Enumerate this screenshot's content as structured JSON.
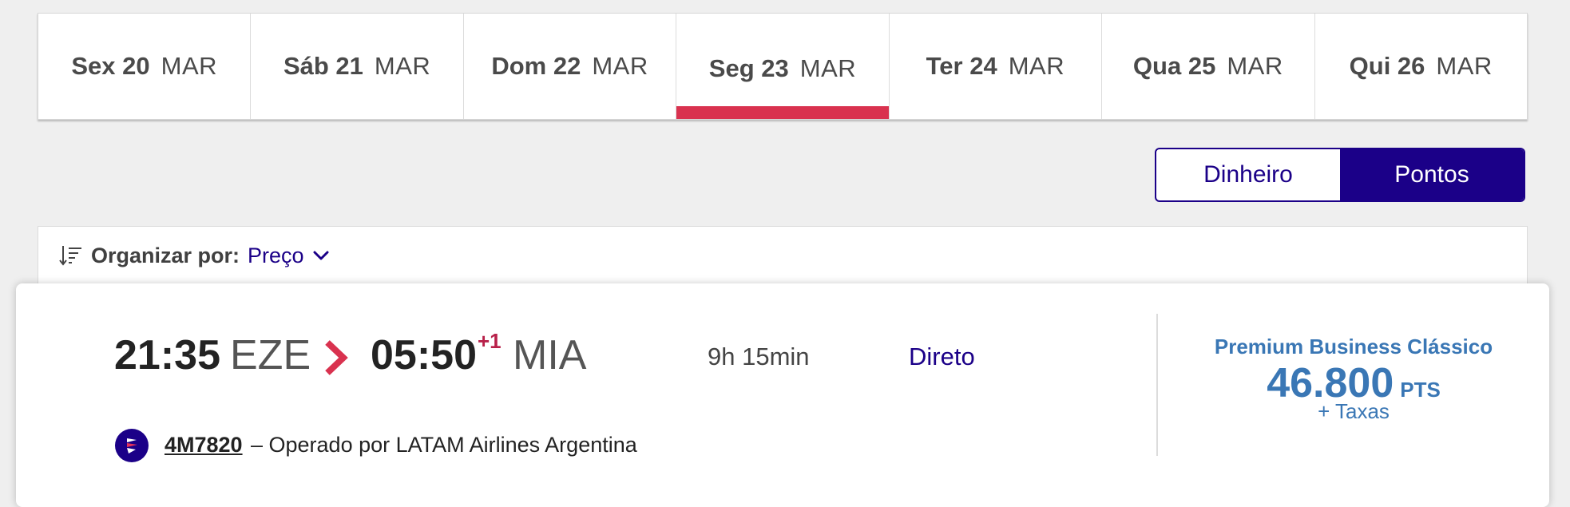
{
  "dates": [
    {
      "day": "Sex 20",
      "month": "MAR",
      "active": false
    },
    {
      "day": "Sáb 21",
      "month": "MAR",
      "active": false
    },
    {
      "day": "Dom 22",
      "month": "MAR",
      "active": false
    },
    {
      "day": "Seg 23",
      "month": "MAR",
      "active": true
    },
    {
      "day": "Ter 24",
      "month": "MAR",
      "active": false
    },
    {
      "day": "Qua 25",
      "month": "MAR",
      "active": false
    },
    {
      "day": "Qui 26",
      "month": "MAR",
      "active": false
    }
  ],
  "toggle": {
    "money_label": "Dinheiro",
    "points_label": "Pontos",
    "selected": "Pontos"
  },
  "sort": {
    "label": "Organizar por:",
    "value": "Preço"
  },
  "flight": {
    "departure_time": "21:35",
    "departure_code": "EZE",
    "arrival_time": "05:50",
    "arrival_day_offset": "+1",
    "arrival_code": "MIA",
    "duration": "9h 15min",
    "stops": "Direto",
    "flight_number": "4M7820",
    "operated_by": "– Operado por LATAM Airlines Argentina",
    "fare": {
      "class_name": "Premium Business Clássico",
      "amount": "46.800",
      "unit": "PTS",
      "taxes": "+ Taxas"
    }
  },
  "colors": {
    "accent_red": "#d9324f",
    "brand_navy": "#1b0088",
    "price_blue": "#3a77b5"
  },
  "icons": {
    "sort": "sort-icon",
    "chevron": "chevron-down-icon",
    "arrow": "chevron-right-icon",
    "airline": "latam-logo-icon"
  }
}
